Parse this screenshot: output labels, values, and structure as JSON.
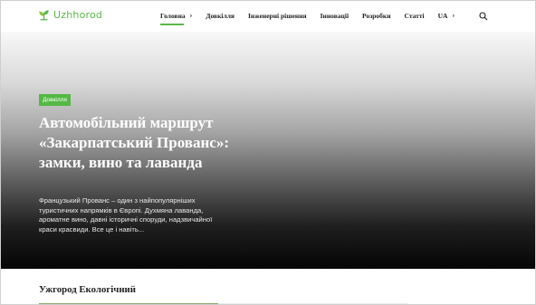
{
  "logo": {
    "text": "Uzhhorod",
    "icon": "leaf-icon",
    "color": "#58b947"
  },
  "nav": {
    "items": [
      {
        "label": "Головна",
        "has_chevron": true,
        "active": true
      },
      {
        "label": "Довкілля",
        "has_chevron": false
      },
      {
        "label": "Інженерні рішення",
        "has_chevron": false
      },
      {
        "label": "Інновації",
        "has_chevron": false
      },
      {
        "label": "Розробки",
        "has_chevron": false
      },
      {
        "label": "Статті",
        "has_chevron": false
      },
      {
        "label": "UA",
        "has_chevron": true
      }
    ],
    "search_icon": "search-icon"
  },
  "hero": {
    "badge": "Довкілля",
    "title": "Автомобільний маршрут «Закарпатський Прованс»: замки, вино та лаванда",
    "description": "Французький Прованс – один з найпопулярніших туристичних напрямків в Європі. Духмяна лаванда, ароматне вино, давні історичні споруди, надзвичайної краси красвиди. Все це і навіть..."
  },
  "section": {
    "title": "Ужгород Екологічний"
  },
  "colors": {
    "accent": "#58b947",
    "badge": "#54b845"
  }
}
